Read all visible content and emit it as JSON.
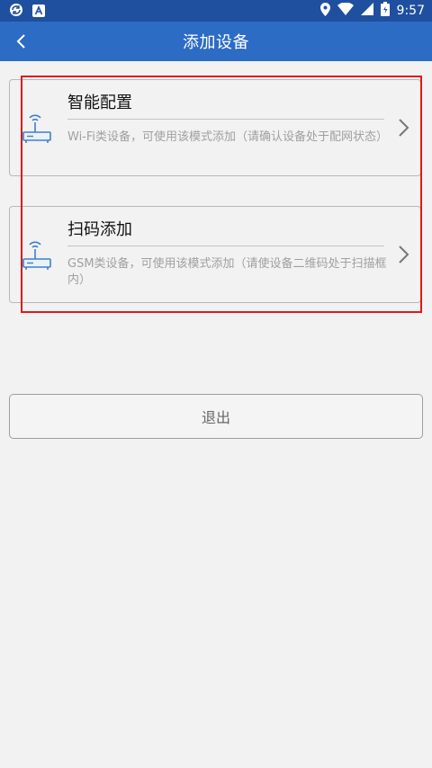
{
  "status_bar": {
    "time": "9:57",
    "icons": [
      "sync-icon",
      "app-a-icon",
      "location-icon",
      "wifi-icon",
      "signal-icon",
      "battery-icon"
    ]
  },
  "app_bar": {
    "title": "添加设备",
    "back_icon": "back-arrow-icon"
  },
  "options": [
    {
      "title": "智能配置",
      "description": "Wi-Fi类设备，可使用该模式添加（请确认设备处于配网状态）",
      "icon": "router-icon"
    },
    {
      "title": "扫码添加",
      "description": "GSM类设备，可使用该模式添加（请使设备二维码处于扫描框内）",
      "icon": "router-icon"
    }
  ],
  "exit_button": {
    "label": "退出"
  },
  "colors": {
    "status_bar": "#1f4f9f",
    "app_bar": "#2c6cc4",
    "highlight": "#e01818",
    "background": "#f2f2f2"
  }
}
